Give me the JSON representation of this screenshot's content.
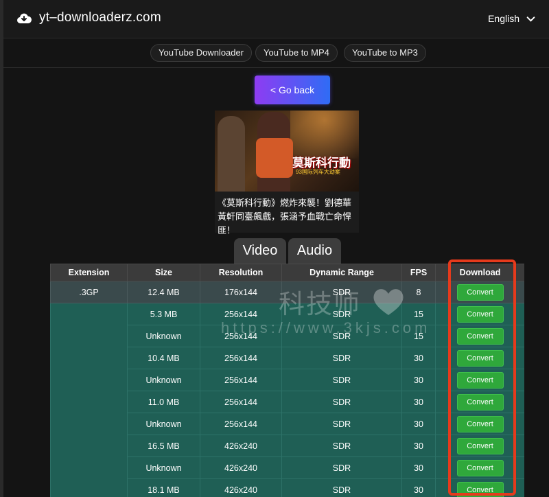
{
  "header": {
    "site_title": "yt–downloaderz.com",
    "language": "English",
    "logo_icon": "cloud-download-icon"
  },
  "nav": {
    "items": [
      "YouTube Downloader",
      "YouTube to MP4",
      "YouTube to MP3"
    ]
  },
  "go_back_label": "< Go back",
  "video": {
    "thumbnail_title": "莫斯科行動",
    "thumbnail_subtitle": "93国际列车大劫案",
    "caption": "《莫斯科行動》燃炸來襲！劉德華黃軒同臺飆戲，張涵予血戰亡命悍匪！"
  },
  "tabs": [
    "Video",
    "Audio"
  ],
  "table": {
    "columns": [
      "Extension",
      "Size",
      "Resolution",
      "Dynamic Range",
      "FPS",
      "Download"
    ],
    "extension": ".3GP",
    "button_label": "Convert",
    "rows": [
      {
        "size": "12.4 MB",
        "resolution": "176x144",
        "range": "SDR",
        "fps": "8"
      },
      {
        "size": "5.3 MB",
        "resolution": "256x144",
        "range": "SDR",
        "fps": "15"
      },
      {
        "size": "Unknown",
        "resolution": "256x144",
        "range": "SDR",
        "fps": "15"
      },
      {
        "size": "10.4 MB",
        "resolution": "256x144",
        "range": "SDR",
        "fps": "30"
      },
      {
        "size": "Unknown",
        "resolution": "256x144",
        "range": "SDR",
        "fps": "30"
      },
      {
        "size": "11.0 MB",
        "resolution": "256x144",
        "range": "SDR",
        "fps": "30"
      },
      {
        "size": "Unknown",
        "resolution": "256x144",
        "range": "SDR",
        "fps": "30"
      },
      {
        "size": "16.5 MB",
        "resolution": "426x240",
        "range": "SDR",
        "fps": "30"
      },
      {
        "size": "Unknown",
        "resolution": "426x240",
        "range": "SDR",
        "fps": "30"
      },
      {
        "size": "18.1 MB",
        "resolution": "426x240",
        "range": "SDR",
        "fps": "30"
      }
    ]
  },
  "watermark": {
    "text": "科技师",
    "url": "https://www.3kjs.com"
  },
  "colors": {
    "accent_gradient_start": "#8e3cf2",
    "accent_gradient_end": "#2f6cf5",
    "table_bg": "#1f5f55",
    "convert_green": "#2fa83b",
    "highlight_red": "#e63a1c"
  }
}
